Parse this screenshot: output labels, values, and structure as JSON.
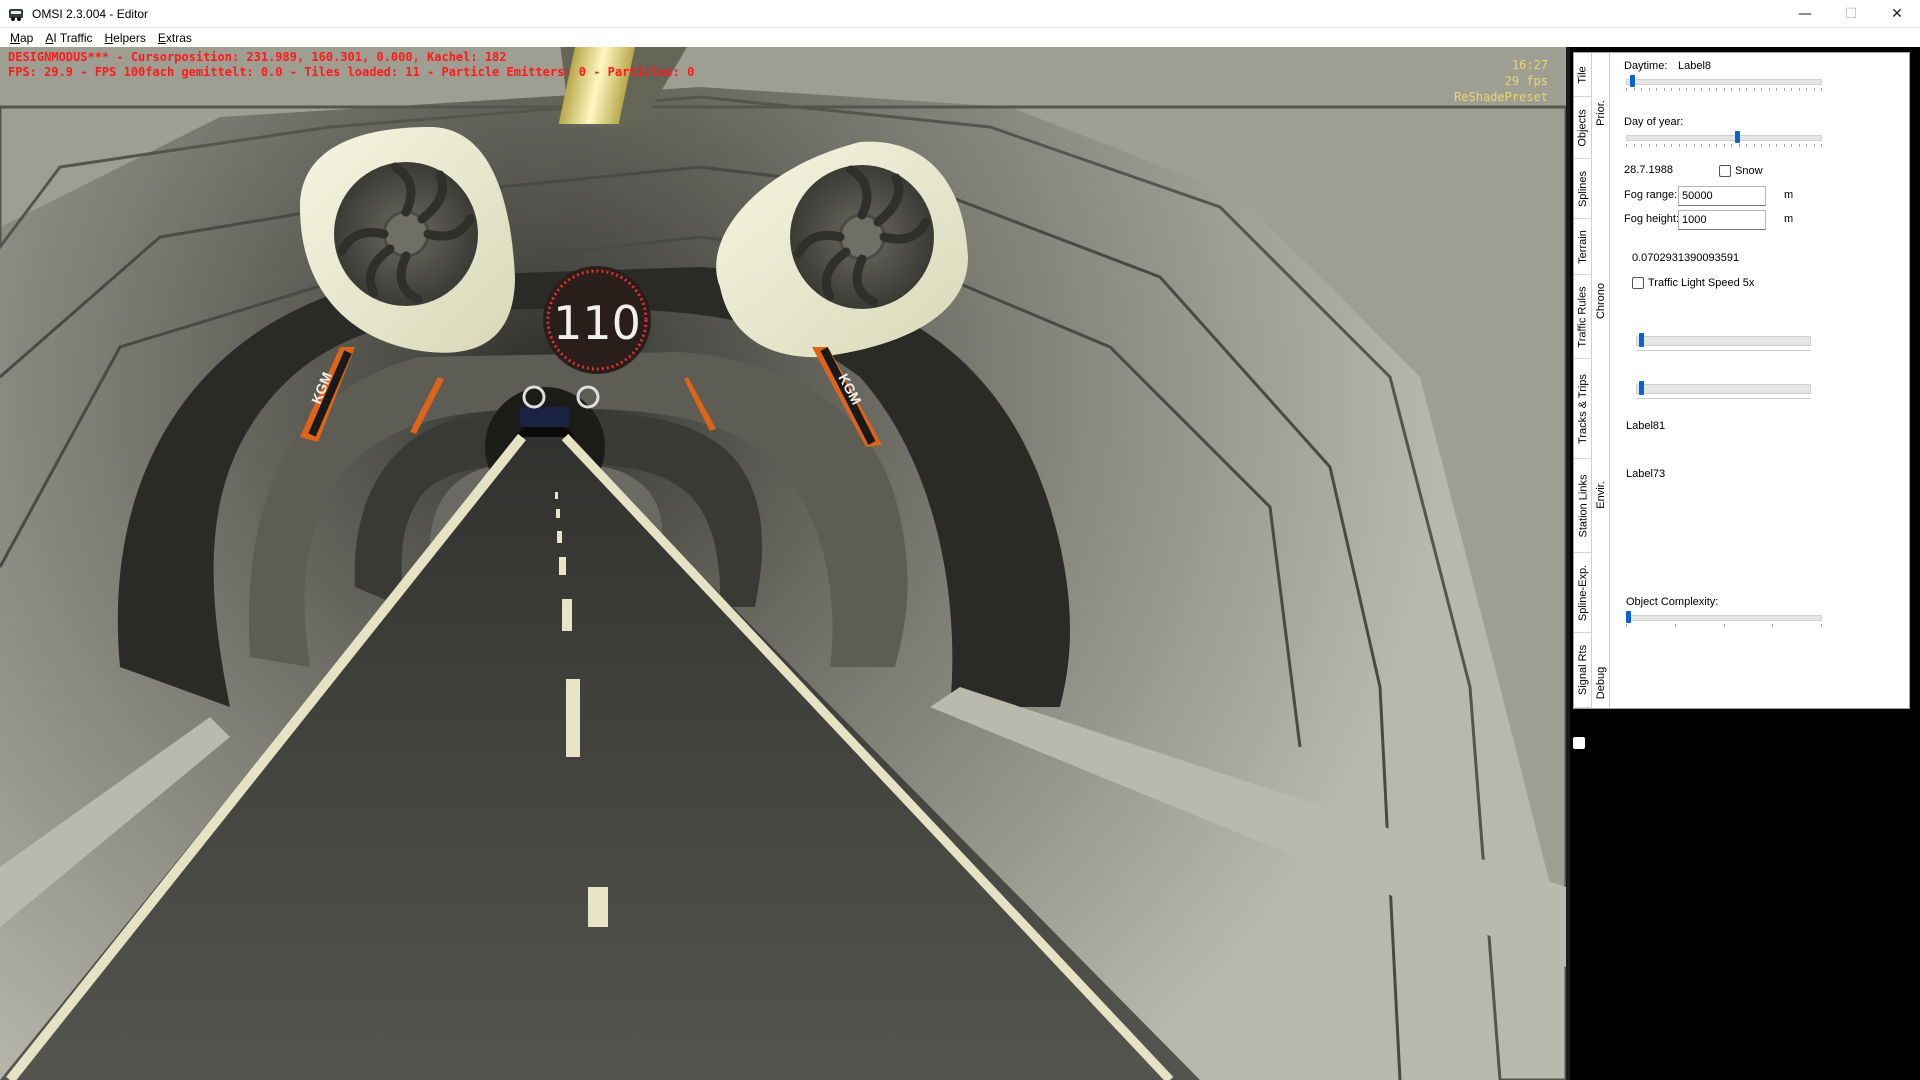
{
  "window": {
    "title": "OMSI 2.3.004 - Editor",
    "controls": {
      "minimize": "—",
      "maximize": "☐",
      "close": "✕"
    }
  },
  "menu": [
    {
      "label_u": "M",
      "label_rest": "ap"
    },
    {
      "label_u": "A",
      "label_rest": "I Traffic"
    },
    {
      "label_u": "H",
      "label_rest": "elpers"
    },
    {
      "label_u": "E",
      "label_rest": "xtras"
    }
  ],
  "viewport": {
    "hud_line1": "DESIGNMODUS*** - Cursorposition: 231.989, 160.301, 0.000, Kachel: 182",
    "hud_line2": "FPS: 29.9 - FPS 100fach gemittelt: 0.0 - Tiles loaded: 11 - Particle Emitters: 0 - Particles: 0",
    "clock": "16:27",
    "fps": "29 fps",
    "preset": "ReShadePreset",
    "speed_sign": "110",
    "wall_logo": "KGM"
  },
  "tabs_outer": [
    "Tile",
    "Objects",
    "Splines",
    "Terrain",
    "Traffic Rules",
    "Tracks & Trips",
    "Station Links",
    "Spline-Exp.",
    "Signal Rts"
  ],
  "tabs_inner": [
    "Prior.",
    "Chrono",
    "Envir.",
    "Debug"
  ],
  "envir": {
    "daytime_label": "Daytime:",
    "daytime_value": "Label8",
    "daytime_slider": 0.02,
    "day_of_year_label": "Day of year:",
    "day_of_year_slider": 0.57,
    "date": "28.7.1988",
    "snow_label": "Snow",
    "snow_checked": false,
    "fog_range_label": "Fog range:",
    "fog_range_value": "50000",
    "fog_range_unit": "m",
    "fog_height_label": "Fog height:",
    "fog_height_value": "1000",
    "fog_height_unit": "m",
    "value_readout": "0.0702931390093591",
    "traffic_light_label": "Traffic Light Speed 5x",
    "traffic_light_checked": false,
    "slider_a": 0.02,
    "slider_b": 0.02,
    "label81": "Label81",
    "label73": "Label73",
    "object_complexity_label": "Object Complexity:",
    "object_complexity_slider": 0.0
  }
}
